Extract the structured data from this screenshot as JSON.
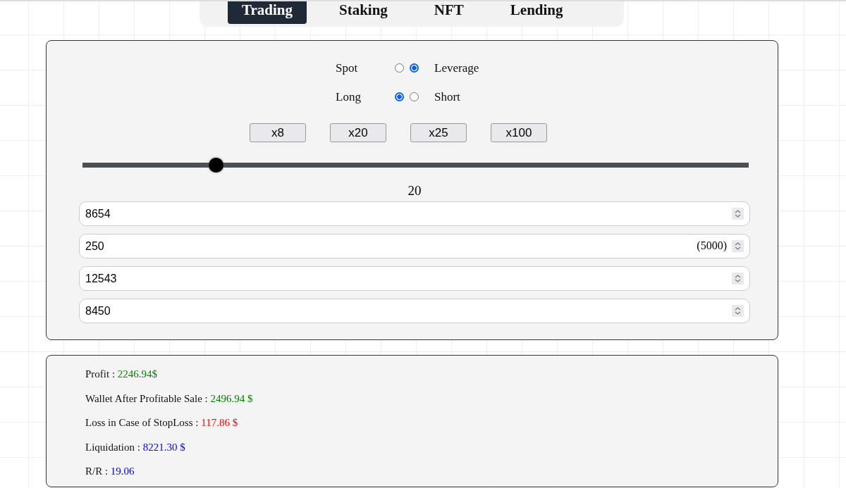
{
  "tabs": [
    {
      "label": "Trading",
      "selected": true
    },
    {
      "label": "Staking",
      "selected": false
    },
    {
      "label": "NFT",
      "selected": false
    },
    {
      "label": "Lending",
      "selected": false
    }
  ],
  "trade_type": [
    {
      "label": "Spot",
      "selected": false
    },
    {
      "label": "Leverage",
      "selected": true
    }
  ],
  "direction": [
    {
      "label": "Long",
      "selected": true
    },
    {
      "label": "Short",
      "selected": false
    }
  ],
  "leverage_presets": [
    "x8",
    "x20",
    "x25",
    "x100"
  ],
  "leverage_slider": {
    "level": 0.2,
    "reading": "20"
  },
  "inputs": [
    {
      "value": "8654"
    },
    {
      "value": "250",
      "suffix": "(5000)"
    },
    {
      "value": "12543"
    },
    {
      "value": "8450"
    }
  ],
  "results": [
    {
      "label": "Profit : ",
      "value": "2246.94$",
      "color": "#008000"
    },
    {
      "label": "Wallet After Profitable Sale : ",
      "value": "2496.94 $",
      "color": "#008000"
    },
    {
      "label": "Loss in Case of StopLoss : ",
      "value": "117.86 $",
      "color": "#ff0000"
    },
    {
      "label": "Liquidation : ",
      "value": "8221.30 $",
      "color": "#0000ff"
    },
    {
      "label": "R/R : ",
      "value": "19.06",
      "color": "#0000ff"
    }
  ]
}
